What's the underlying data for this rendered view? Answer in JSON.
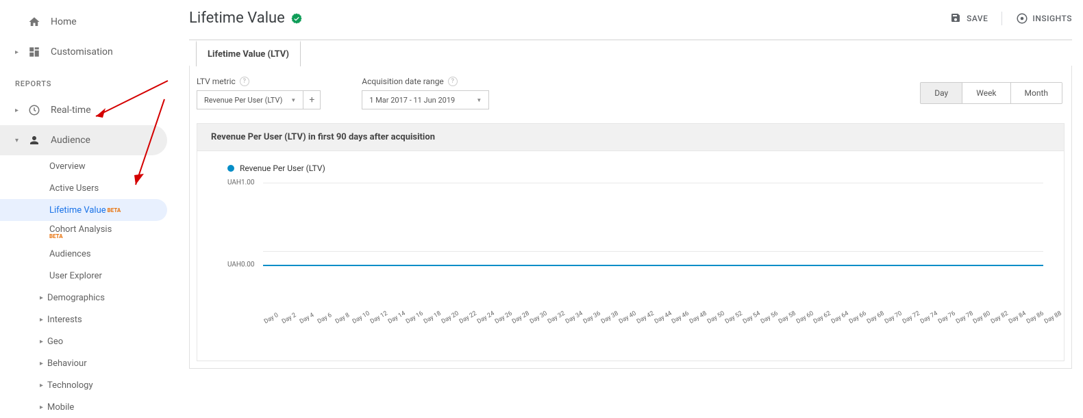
{
  "sidebar": {
    "home": "Home",
    "customisation": "Customisation",
    "section_reports": "REPORTS",
    "realtime": "Real-time",
    "audience": "Audience",
    "sub": {
      "overview": "Overview",
      "active_users": "Active Users",
      "lifetime_value": "Lifetime Value",
      "lifetime_value_beta": "BETA",
      "cohort": "Cohort Analysis",
      "cohort_beta": "BETA",
      "audiences": "Audiences",
      "user_explorer": "User Explorer",
      "demographics": "Demographics",
      "interests": "Interests",
      "geo": "Geo",
      "behaviour": "Behaviour",
      "technology": "Technology",
      "mobile": "Mobile"
    }
  },
  "header": {
    "title": "Lifetime Value",
    "save": "SAVE",
    "insights": "INSIGHTS"
  },
  "tabs": {
    "ltv": "Lifetime Value (LTV)"
  },
  "controls": {
    "metric_label": "LTV metric",
    "metric_value": "Revenue Per User (LTV)",
    "date_label": "Acquisition date range",
    "date_value": "1 Mar 2017 - 11 Jun 2019",
    "plus": "+"
  },
  "toggle": {
    "day": "Day",
    "week": "Week",
    "month": "Month"
  },
  "chart": {
    "title": "Revenue Per User (LTV) in first 90 days after acquisition",
    "legend": "Revenue Per User (LTV)"
  },
  "chart_data": {
    "type": "line",
    "title": "Revenue Per User (LTV) in first 90 days after acquisition",
    "ylabel": "Revenue Per User",
    "xlabel": "Day",
    "ylim": [
      0,
      1
    ],
    "yticks": [
      "UAH1.00",
      "UAH0.00"
    ],
    "x": [
      0,
      2,
      4,
      6,
      8,
      10,
      12,
      14,
      16,
      18,
      20,
      22,
      24,
      26,
      28,
      30,
      32,
      34,
      36,
      38,
      40,
      42,
      44,
      46,
      48,
      50,
      52,
      54,
      56,
      58,
      60,
      62,
      64,
      66,
      68,
      70,
      72,
      74,
      76,
      78,
      80,
      82,
      84,
      86,
      88
    ],
    "series": [
      {
        "name": "Revenue Per User (LTV)",
        "values": [
          0,
          0,
          0,
          0,
          0,
          0,
          0,
          0,
          0,
          0,
          0,
          0,
          0,
          0,
          0,
          0,
          0,
          0,
          0,
          0,
          0,
          0,
          0,
          0,
          0,
          0,
          0,
          0,
          0,
          0,
          0,
          0,
          0,
          0,
          0,
          0,
          0,
          0,
          0,
          0,
          0,
          0,
          0,
          0,
          0
        ],
        "color": "#058dc7"
      }
    ]
  }
}
